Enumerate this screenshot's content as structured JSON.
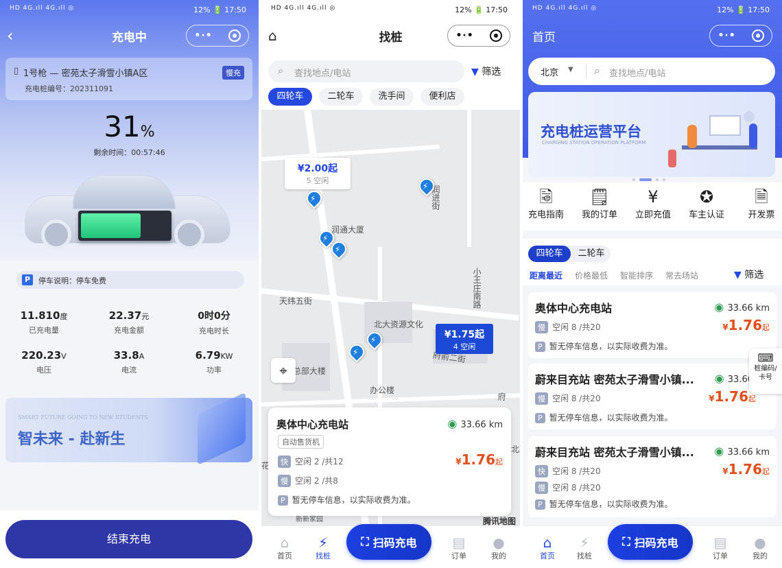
{
  "status": {
    "left": "HD 4G.ıll 4G.ıll ◎",
    "right": "12% 🔋 17:50"
  },
  "p1": {
    "title": "充电中",
    "gun": "1号枪 — 密苑太子滑雪小镇A区",
    "gun_badge": "慢充",
    "pile_no": "充电桩编号：202311091",
    "percent": "31",
    "percent_unit": "%",
    "battery_level": 0.31,
    "remain": "剩余时间：00:57:46",
    "parking": "停车说明：停车免费",
    "stats": [
      {
        "value": "11.810",
        "unit": "度",
        "label": "已充电量"
      },
      {
        "value": "22.37",
        "unit": "元",
        "label": "充电金额"
      },
      {
        "value": "0时0分",
        "unit": "",
        "label": "充电时长"
      },
      {
        "value": "220.23",
        "unit": "V",
        "label": "电压"
      },
      {
        "value": "33.8",
        "unit": "A",
        "label": "电流"
      },
      {
        "value": "6.79",
        "unit": "KW",
        "label": "功率"
      }
    ],
    "banner_small": "SMART FUTURE GOING TO NEW STUDENTS",
    "banner_big": "智未来 - 赴新生",
    "end_btn": "结束充电"
  },
  "p2": {
    "title": "找桩",
    "search_placeholder": "查找地点/电站",
    "filter": "筛选",
    "chips": [
      "四轮车",
      "二轮车",
      "洗手间",
      "便利店"
    ],
    "map_labels": {
      "a": "润通大厦",
      "b": "天纬五街",
      "c": "北大资源文化",
      "d": "总部大楼",
      "e": "办公楼",
      "f": "小王庄南路",
      "g": "府前二街",
      "h": "润进街",
      "i": "府",
      "j": "北",
      "k": "花",
      "l": "新新家园"
    },
    "bubble1": {
      "price": "¥2.00起",
      "free": "5 空闲"
    },
    "bubble2": {
      "price": "¥1.75起",
      "free": "4 空闲"
    },
    "card": {
      "name": "奥体中心充电站",
      "dist": "33.66 km",
      "tag": "自动售货机",
      "fast": "空闲 2 /共12",
      "slow": "空闲 2 /共8",
      "price": "1.76",
      "parking": "暂无停车信息，以实际收费为准。",
      "fast_tag": "快",
      "slow_tag": "慢",
      "p_tag": "P",
      "yen": "¥",
      "qi": "起"
    },
    "map_brand": "腾讯地图",
    "tabs": [
      "首页",
      "找桩",
      "订单",
      "我的"
    ],
    "scan": "扫码充电"
  },
  "p3": {
    "title": "首页",
    "city": "北京",
    "search_placeholder": "查找地点/电站",
    "banner_title": "充电桩运营平台",
    "banner_sub": "CHARGING STATION OPERATION PLATFORM",
    "icons": [
      {
        "name": "充电指南",
        "icon": "guide-icon"
      },
      {
        "name": "我的订单",
        "icon": "order-icon"
      },
      {
        "name": "立即充值",
        "icon": "recharge-icon"
      },
      {
        "name": "车主认证",
        "icon": "certify-icon"
      },
      {
        "name": "开发票",
        "icon": "invoice-icon"
      }
    ],
    "seg": [
      "四轮车",
      "二轮车"
    ],
    "sort": [
      "距离最近",
      "价格最低",
      "智能排序",
      "常去场站"
    ],
    "filter": "筛选",
    "stations": [
      {
        "name": "奥体中心充电站",
        "dist": "33.66 km",
        "line1": "空闲 8 /共20",
        "line1_tag": "慢",
        "line2": "",
        "line2_tag": "",
        "price": "1.76",
        "parking": "暂无停车信息，以实际收费为准。"
      },
      {
        "name": "蔚来目充站 密苑太子滑雪小镇...",
        "dist": "33.66",
        "line1": "空闲 8 /共20",
        "line1_tag": "慢",
        "line2": "",
        "line2_tag": "",
        "price": "1.76",
        "parking": "暂无停车信息，以实际收费为准。"
      },
      {
        "name": "蔚来目充站 密苑太子滑雪小镇...",
        "dist": "33.66 km",
        "line1": "空闲 8 /共20",
        "line1_tag": "快",
        "line2": "空闲 8 /共20",
        "line2_tag": "慢",
        "price": "1.76",
        "parking": "暂无停车信息，以实际收费为准。"
      }
    ],
    "float_btn": "桩编码/卡号",
    "tabs": [
      "首页",
      "找桩",
      "订单",
      "我的"
    ],
    "scan": "扫码充电"
  },
  "colors": {
    "primary": "#2448e0",
    "price": "#e24f1c",
    "header": "#5f7cf0"
  }
}
